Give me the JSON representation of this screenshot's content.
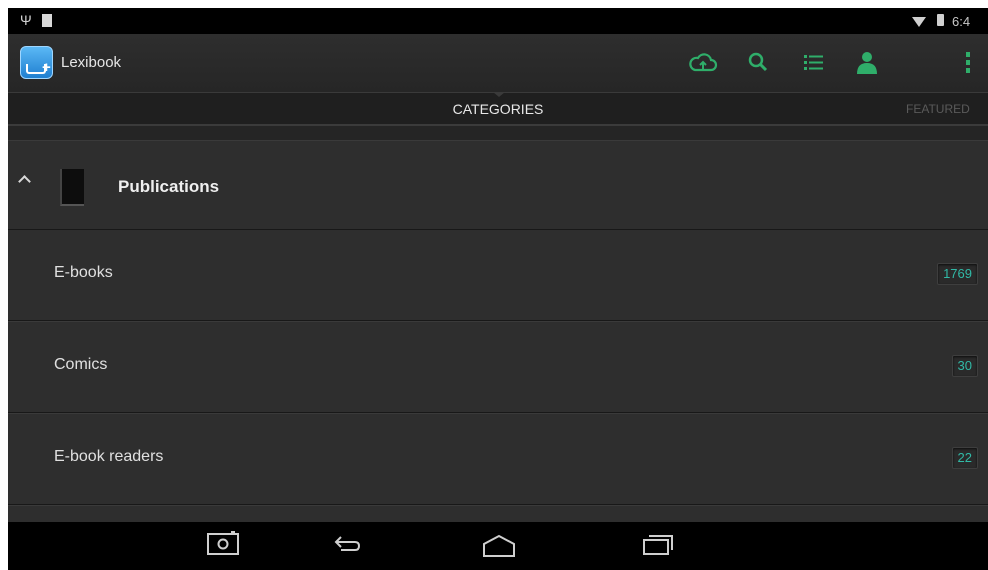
{
  "status_bar": {
    "time": "6:4",
    "icons": [
      "usb-icon",
      "notification-square-icon",
      "wifi-icon",
      "battery-icon"
    ]
  },
  "action_bar": {
    "app_name": "Lexibook",
    "icons": [
      "cloud-upload-icon",
      "search-icon",
      "list-icon",
      "account-icon",
      "overflow-menu-icon"
    ],
    "accent_color": "#2fae6a"
  },
  "tabs": {
    "active": "CATEGORIES",
    "next": "FEATURED"
  },
  "group": {
    "title": "Publications",
    "expanded": true,
    "icon": "book-icon"
  },
  "categories": [
    {
      "label": "E-books",
      "count": "1769"
    },
    {
      "label": "Comics",
      "count": "30"
    },
    {
      "label": "E-book readers",
      "count": "22"
    }
  ],
  "badge_color": "#31b9a6",
  "nav_bar": {
    "icons": [
      "screenshot-icon",
      "back-icon",
      "home-icon",
      "recents-icon"
    ]
  }
}
